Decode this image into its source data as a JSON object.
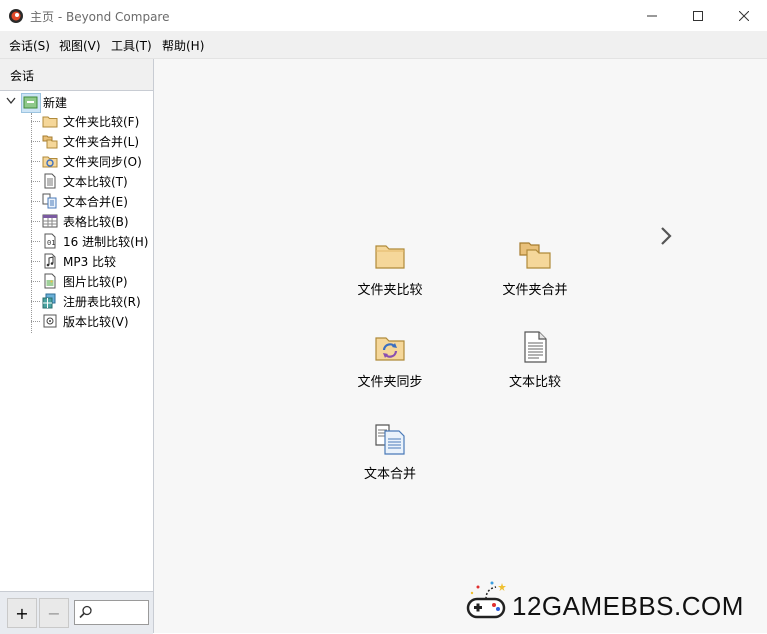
{
  "window": {
    "title": "主页 - Beyond Compare"
  },
  "menu": [
    "会话(S)",
    "视图(V)",
    "工具(T)",
    "帮助(H)"
  ],
  "sidebar": {
    "header": "会话",
    "root": "新建",
    "items": [
      {
        "label": "文件夹比较(F)",
        "icon": "folder-icon"
      },
      {
        "label": "文件夹合并(L)",
        "icon": "folder-merge-icon"
      },
      {
        "label": "文件夹同步(O)",
        "icon": "folder-sync-icon"
      },
      {
        "label": "文本比较(T)",
        "icon": "text-document-icon"
      },
      {
        "label": "文本合并(E)",
        "icon": "text-merge-icon"
      },
      {
        "label": "表格比较(B)",
        "icon": "table-icon"
      },
      {
        "label": "16 进制比较(H)",
        "icon": "hex-icon"
      },
      {
        "label": "MP3 比较",
        "icon": "music-icon"
      },
      {
        "label": "图片比较(P)",
        "icon": "image-icon"
      },
      {
        "label": "注册表比较(R)",
        "icon": "registry-icon"
      },
      {
        "label": "版本比较(V)",
        "icon": "version-icon"
      }
    ],
    "footer": {
      "add": "+",
      "remove": "−",
      "search_placeholder": ""
    }
  },
  "main": {
    "tiles": [
      {
        "label": "文件夹比较",
        "icon": "folder-icon"
      },
      {
        "label": "文件夹合并",
        "icon": "folder-merge-icon"
      },
      {
        "label": "文件夹同步",
        "icon": "folder-sync-icon"
      },
      {
        "label": "文本比较",
        "icon": "text-document-icon"
      },
      {
        "label": "文本合并",
        "icon": "text-merge-icon"
      }
    ]
  },
  "watermark": {
    "text": "12GAMEBBS.COM"
  }
}
